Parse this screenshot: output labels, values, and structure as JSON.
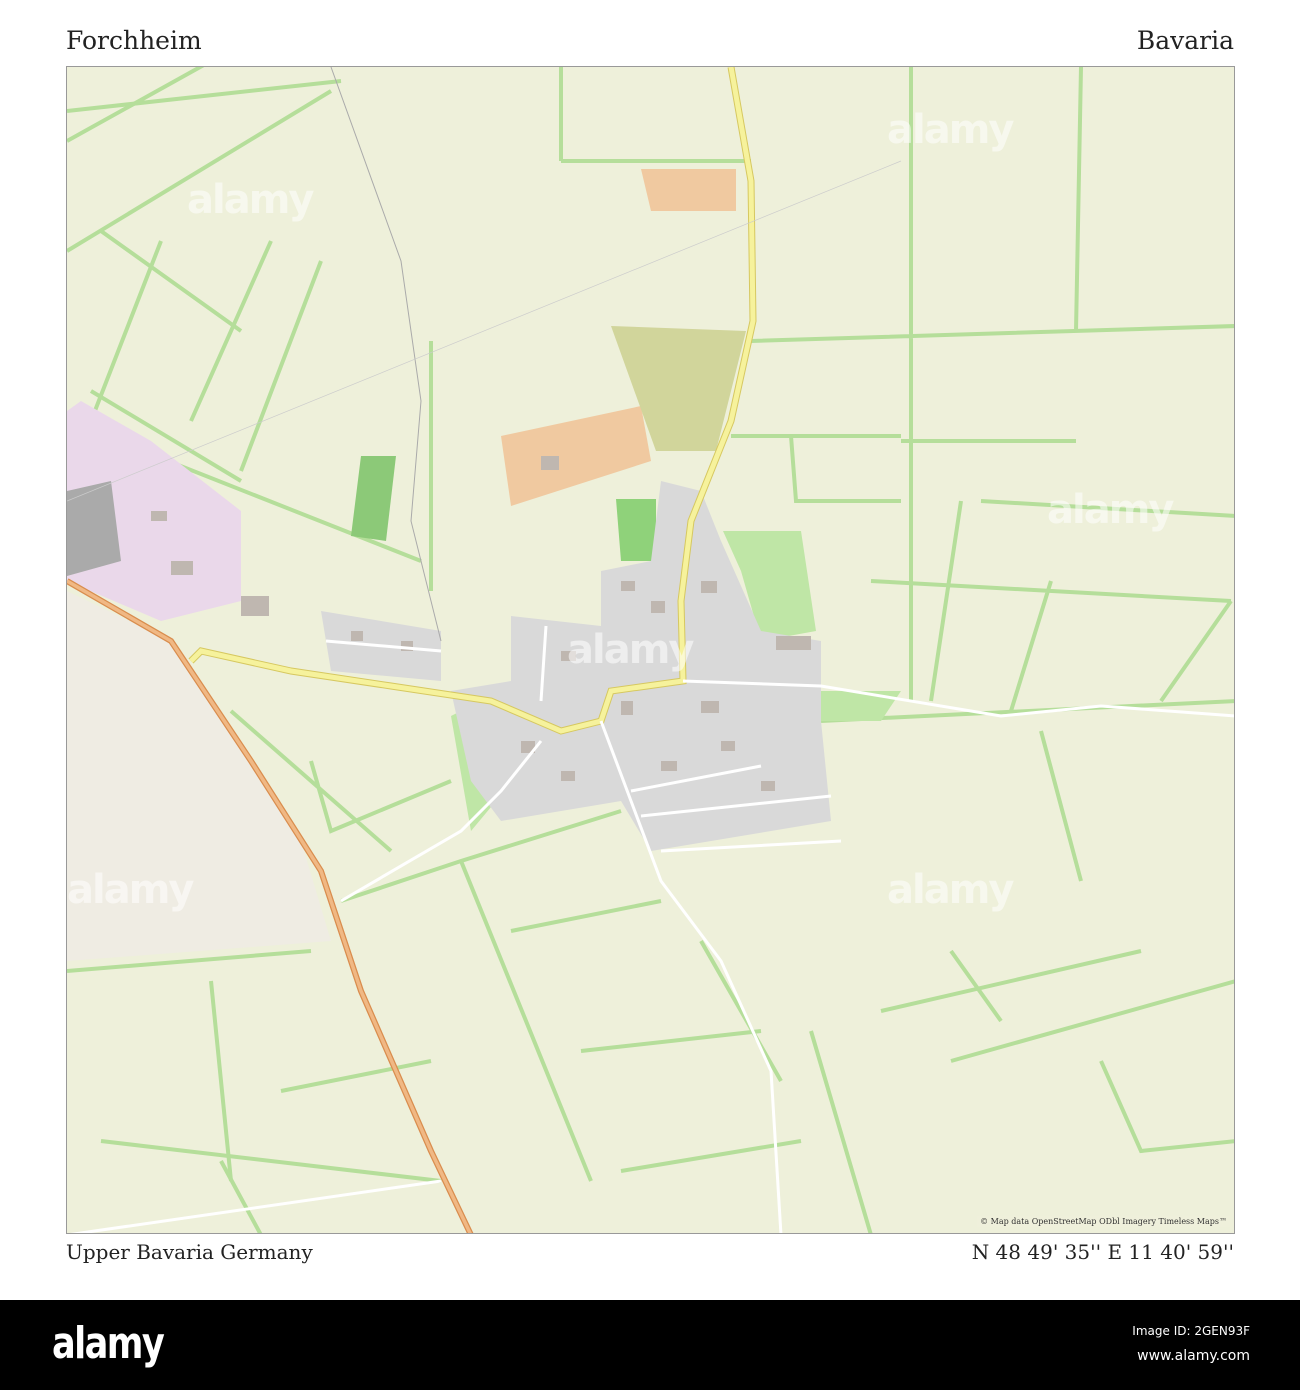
{
  "header": {
    "title": "Forchheim",
    "region": "Bavaria"
  },
  "footer_text": {
    "subtitle": "Upper Bavaria  Germany",
    "coordinates": "N 48 49' 35''   E 11 40' 59''"
  },
  "map": {
    "attribution": "© Map data OpenStreetMap ODbl Imagery Timeless Maps™",
    "watermark": "alamy",
    "colors": {
      "field": "#eef0da",
      "field_line": "#a8d98a",
      "village": "#d9d9d9",
      "road_main": "#f6f29c",
      "road_orange": "#e8a870",
      "industrial": "#ead8ea",
      "farm": "#f0c9a0"
    }
  },
  "stock_bar": {
    "logo": "alamy",
    "image_id": "Image ID: 2GEN93F",
    "website": "www.alamy.com"
  }
}
